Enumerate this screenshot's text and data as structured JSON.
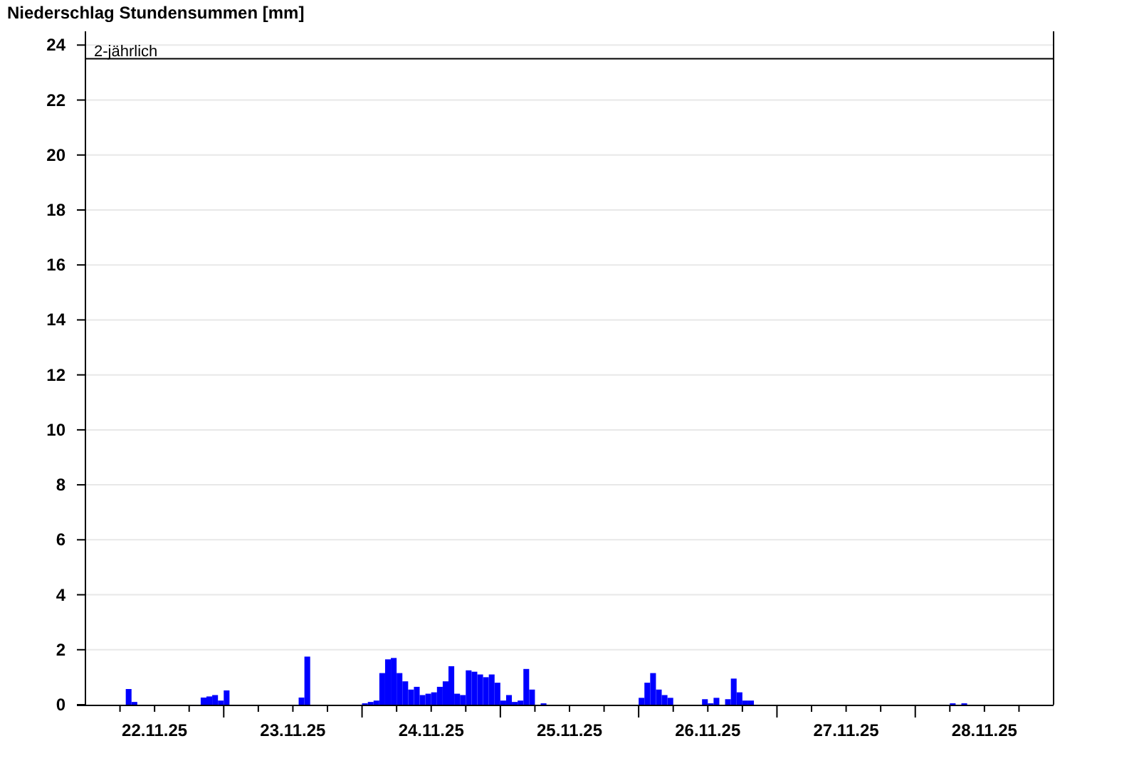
{
  "chart": {
    "chart_data": {
      "type": "bar",
      "title": "Niederschlag Stundensummen [mm]",
      "ylim": [
        0,
        24.5
      ],
      "yticks": [
        0,
        2,
        4,
        6,
        8,
        10,
        12,
        14,
        16,
        18,
        20,
        22,
        24
      ],
      "categories": [
        null,
        null,
        null,
        null,
        null,
        null,
        null,
        null,
        null,
        null,
        null,
        null,
        "22.11.25",
        null,
        null,
        null,
        null,
        null,
        null,
        null,
        null,
        null,
        null,
        null,
        null,
        null,
        null,
        null,
        null,
        null,
        null,
        null,
        null,
        null,
        null,
        null,
        "23.11.25",
        null,
        null,
        null,
        null,
        null,
        null,
        null,
        null,
        null,
        null,
        null,
        null,
        null,
        null,
        null,
        null,
        null,
        null,
        null,
        null,
        null,
        null,
        null,
        "24.11.25",
        null,
        null,
        null,
        null,
        null,
        null,
        null,
        null,
        null,
        null,
        null,
        null,
        null,
        null,
        null,
        null,
        null,
        null,
        null,
        null,
        null,
        null,
        null,
        "25.11.25",
        null,
        null,
        null,
        null,
        null,
        null,
        null,
        null,
        null,
        null,
        null,
        null,
        null,
        null,
        null,
        null,
        null,
        null,
        null,
        null,
        null,
        null,
        null,
        "26.11.25",
        null,
        null,
        null,
        null,
        null,
        null,
        null,
        null,
        null,
        null,
        null,
        null,
        null,
        null,
        null,
        null,
        null,
        null,
        null,
        null,
        null,
        null,
        null,
        "27.11.25",
        null,
        null,
        null,
        null,
        null,
        null,
        null,
        null,
        null,
        null,
        null,
        null,
        null,
        null,
        null,
        null,
        null,
        null,
        null,
        null,
        null,
        null,
        null,
        "28.11.25",
        null,
        null,
        null,
        null,
        null,
        null,
        null,
        null,
        null,
        null,
        null
      ],
      "series": [
        {
          "color": "#0000ff",
          "values": [
            0,
            0,
            0,
            0,
            0,
            0,
            0,
            0.57,
            0.1,
            0,
            0,
            0,
            0,
            0,
            0,
            0,
            0,
            0,
            0,
            0,
            0.26,
            0.3,
            0.35,
            0.15,
            0.52,
            0,
            0,
            0,
            0,
            0,
            0,
            0,
            0,
            0,
            0,
            0,
            0,
            0.26,
            1.75,
            0,
            0,
            0,
            0,
            0,
            0,
            0,
            0,
            0,
            0.05,
            0.1,
            0.15,
            1.15,
            1.65,
            1.7,
            1.15,
            0.85,
            0.55,
            0.65,
            0.35,
            0.4,
            0.45,
            0.65,
            0.85,
            1.4,
            0.4,
            0.35,
            1.25,
            1.2,
            1.1,
            1.0,
            1.1,
            0.8,
            0.15,
            0.35,
            0.1,
            0.15,
            1.3,
            0.55,
            0,
            0.05,
            0,
            0,
            0,
            0,
            0,
            0,
            0,
            0,
            0,
            0,
            0,
            0,
            0,
            0,
            0,
            0,
            0.25,
            0.8,
            1.15,
            0.55,
            0.35,
            0.25,
            0,
            0,
            0,
            0,
            0,
            0.2,
            0.05,
            0.25,
            0,
            0.2,
            0.95,
            0.45,
            0.15,
            0.15,
            0,
            0,
            0,
            0,
            0,
            0,
            0,
            0,
            0,
            0,
            0,
            0,
            0,
            0,
            0,
            0,
            0,
            0,
            0,
            0,
            0,
            0,
            0,
            0,
            0,
            0,
            0,
            0,
            0,
            0,
            0,
            0,
            0,
            0,
            0.05,
            0,
            0.05,
            0,
            0,
            0,
            0,
            0,
            0,
            0,
            0,
            0,
            0,
            0,
            0,
            0,
            0,
            0
          ]
        }
      ],
      "grid": true,
      "ref_lines": [
        {
          "axis": "y",
          "value": 23.5,
          "label": "2-jährlich"
        }
      ]
    }
  }
}
